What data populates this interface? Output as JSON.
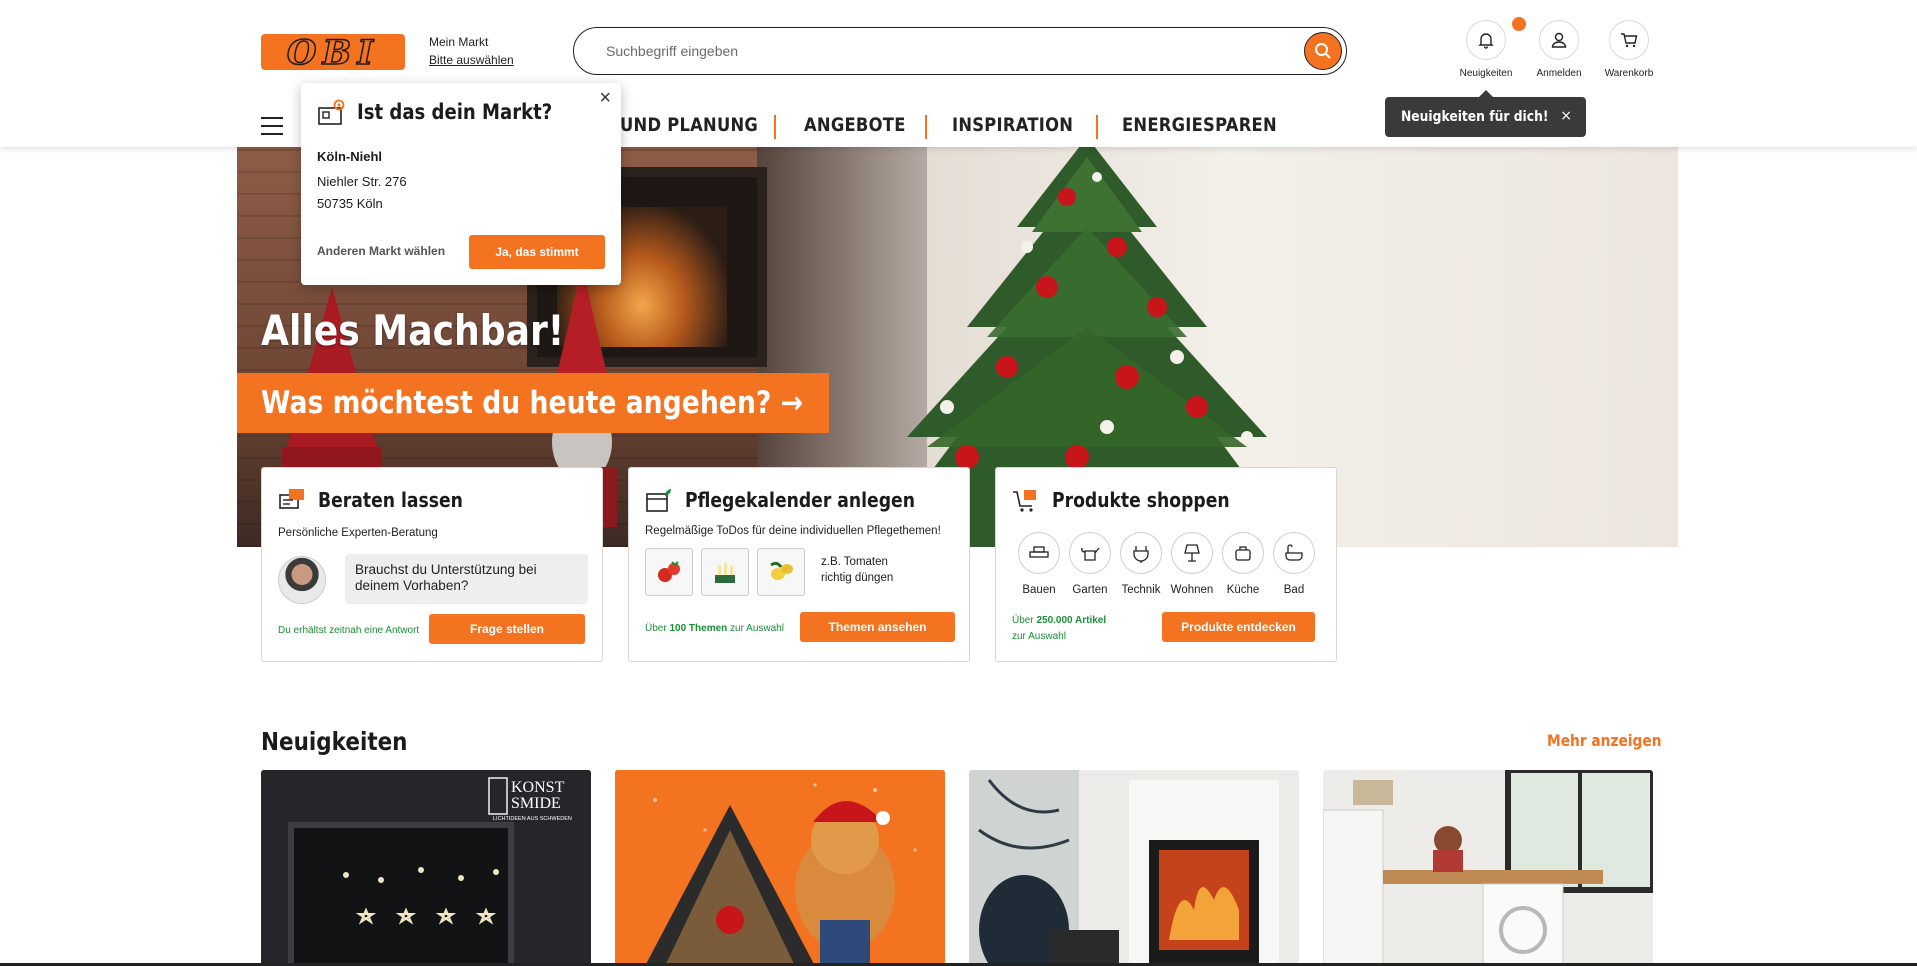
{
  "header": {
    "logo_text": "OBI",
    "market_label": "Mein Markt",
    "market_action": "Bitte auswählen",
    "search_placeholder": "Suchbegriff eingeben",
    "icons": [
      {
        "name": "bell-icon",
        "label": "Neuigkeiten"
      },
      {
        "name": "user-icon",
        "label": "Anmelden"
      },
      {
        "name": "cart-icon",
        "label": "Warenkorb"
      }
    ],
    "nav": [
      "UND PLANUNG",
      "ANGEBOTE",
      "INSPIRATION",
      "ENERGIESPAREN"
    ],
    "news_tooltip": "Neuigkeiten für dich!",
    "tooltip_close": "×"
  },
  "market_popup": {
    "title": "Ist das dein Markt?",
    "name": "Köln-Niehl",
    "street": "Niehler Str. 276",
    "city": "50735 Köln",
    "other_label": "Anderen Markt wählen",
    "confirm_label": "Ja, das stimmt",
    "close": "×"
  },
  "hero": {
    "headline": "Alles Machbar!",
    "cta": "Was möchtest du heute angehen? →"
  },
  "cards": {
    "advice": {
      "title": "Beraten lassen",
      "subtitle": "Persönliche Experten-Beratung",
      "bubble": "Brauchst du Unterstützung bei deinem Vorhaben?",
      "note": "Du erhältst zeitnah eine Antwort",
      "button": "Frage stellen"
    },
    "calendar": {
      "title": "Pflegekalender anlegen",
      "subtitle": "Regelmäßige ToDos für deine individuellen Pflegethemen!",
      "example_line1": "z.B. Tomaten",
      "example_line2": "richtig düngen",
      "note_pre": "Über ",
      "note_bold": "100 Themen",
      "note_post": " zur Auswahl",
      "button": "Themen ansehen"
    },
    "shop": {
      "title": "Produkte shoppen",
      "categories": [
        "Bauen",
        "Garten",
        "Technik",
        "Wohnen",
        "Küche",
        "Bad"
      ],
      "note_pre": "Über ",
      "note_bold": "250.000 Artikel",
      "note_post": "zur Auswahl",
      "button": "Produkte entdecken"
    }
  },
  "news": {
    "heading": "Neuigkeiten",
    "more": "Mehr anzeigen",
    "tile1_brand": "KONST SMIDE",
    "tile1_brand_sub": "LICHTIDEEN AUS SCHWEDEN"
  },
  "colors": {
    "brand_orange": "#f37321",
    "green_note": "#1a8f35",
    "tooltip_bg": "#3a3a3a"
  }
}
